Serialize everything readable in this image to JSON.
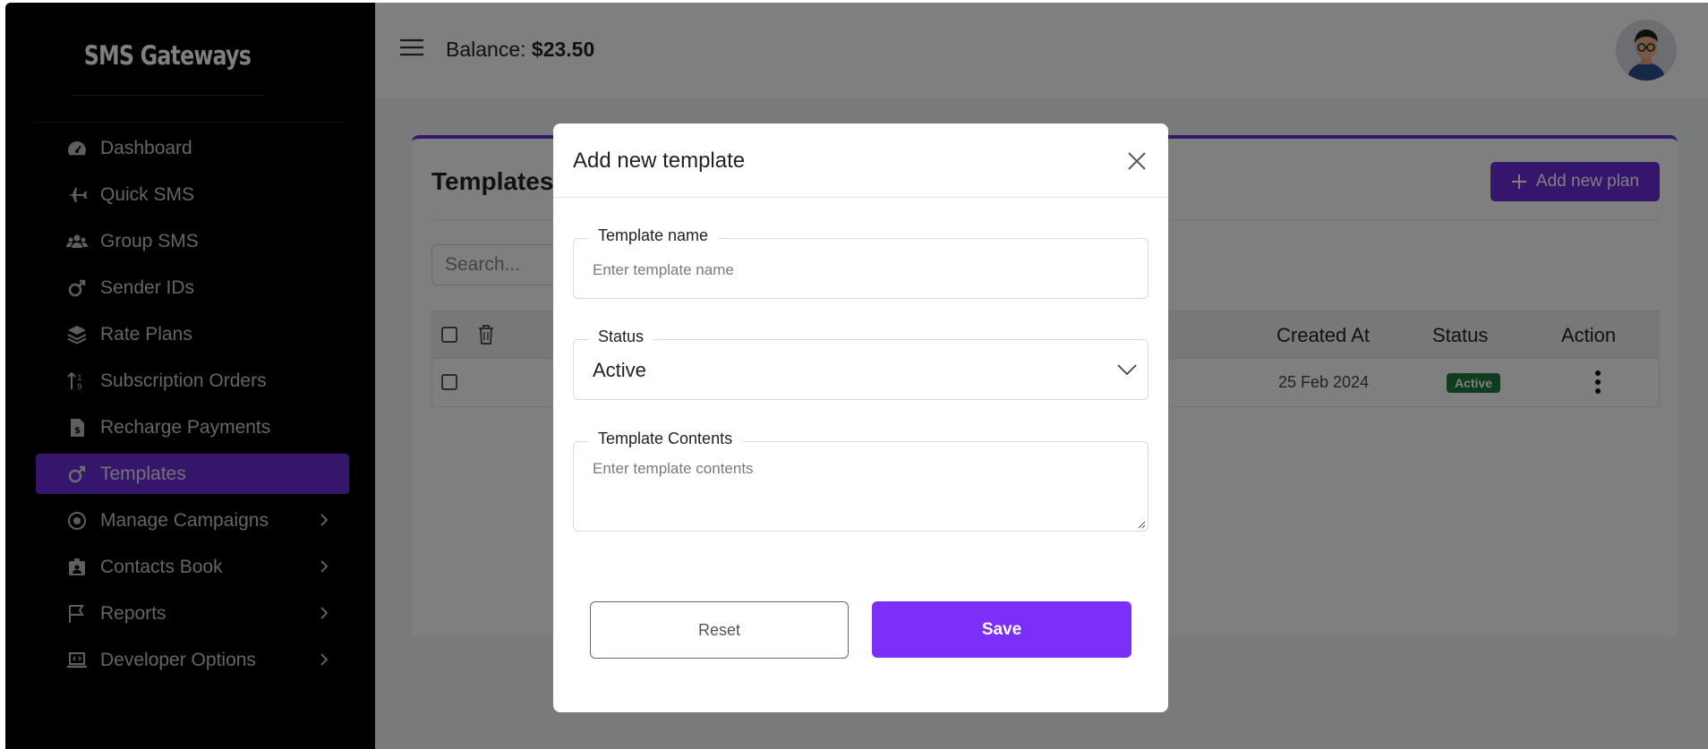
{
  "sidebar": {
    "brand": "SMS Gateways",
    "items": [
      {
        "label": "Dashboard",
        "icon": "speedometer-icon",
        "has_submenu": false
      },
      {
        "label": "Quick SMS",
        "icon": "airplane-icon",
        "has_submenu": false
      },
      {
        "label": "Group SMS",
        "icon": "users-icon",
        "has_submenu": false
      },
      {
        "label": "Sender IDs",
        "icon": "mars-icon",
        "has_submenu": false
      },
      {
        "label": "Rate Plans",
        "icon": "layers-icon",
        "has_submenu": false
      },
      {
        "label": "Subscription Orders",
        "icon": "sort-icon",
        "has_submenu": false
      },
      {
        "label": "Recharge Payments",
        "icon": "invoice-dollar-icon",
        "has_submenu": false
      },
      {
        "label": "Templates",
        "icon": "mars-icon",
        "has_submenu": false,
        "active": true
      },
      {
        "label": "Manage Campaigns",
        "icon": "campaign-icon",
        "has_submenu": true
      },
      {
        "label": "Contacts Book",
        "icon": "id-badge-icon",
        "has_submenu": true
      },
      {
        "label": "Reports",
        "icon": "flag-icon",
        "has_submenu": true
      },
      {
        "label": "Developer Options",
        "icon": "laptop-code-icon",
        "has_submenu": true
      }
    ]
  },
  "header": {
    "balance_label": "Balance:",
    "balance_value": "$23.50"
  },
  "page": {
    "title": "Templates",
    "add_button": "Add new plan",
    "search_placeholder": "Search...",
    "table": {
      "columns": [
        "Created At",
        "Status",
        "Action"
      ],
      "rows": [
        {
          "created_at": "25 Feb 2024",
          "status": "Active"
        }
      ]
    }
  },
  "modal": {
    "title": "Add new template",
    "template_name": {
      "label": "Template name",
      "placeholder": "Enter template name"
    },
    "status": {
      "label": "Status",
      "value": "Active"
    },
    "contents": {
      "label": "Template Contents",
      "placeholder": "Enter template contents"
    },
    "reset_label": "Reset",
    "save_label": "Save"
  },
  "colors": {
    "accent": "#6c2bd9",
    "save_button": "#7b2ff7",
    "active_badge": "#1f7a45",
    "sidebar_bg": "#000000"
  }
}
